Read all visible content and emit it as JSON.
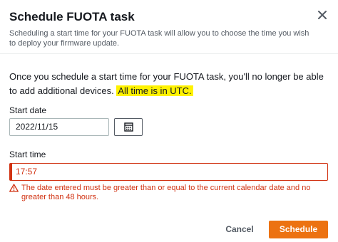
{
  "modal": {
    "title": "Schedule FUOTA task",
    "subtitle": "Scheduling a start time for your FUOTA task will allow you to choose the time you wish to deploy your firmware update.",
    "close_icon": "close-icon"
  },
  "body": {
    "info_text": "Once you schedule a start time for your FUOTA task, you'll no longer be able to add additional devices. ",
    "highlight_text": "All time is in UTC."
  },
  "start_date": {
    "label": "Start date",
    "value": "2022/11/15",
    "calendar_icon": "calendar-icon"
  },
  "start_time": {
    "label": "Start time",
    "value": "17:57",
    "error_icon": "warning-icon",
    "error_text": "The date entered must be greater than or equal to the current calendar date and no greater than 48 hours."
  },
  "footer": {
    "cancel_label": "Cancel",
    "schedule_label": "Schedule"
  },
  "colors": {
    "accent": "#ec7211",
    "error": "#d13212",
    "highlight": "#fff200",
    "text": "#16191f",
    "muted": "#545b64"
  }
}
